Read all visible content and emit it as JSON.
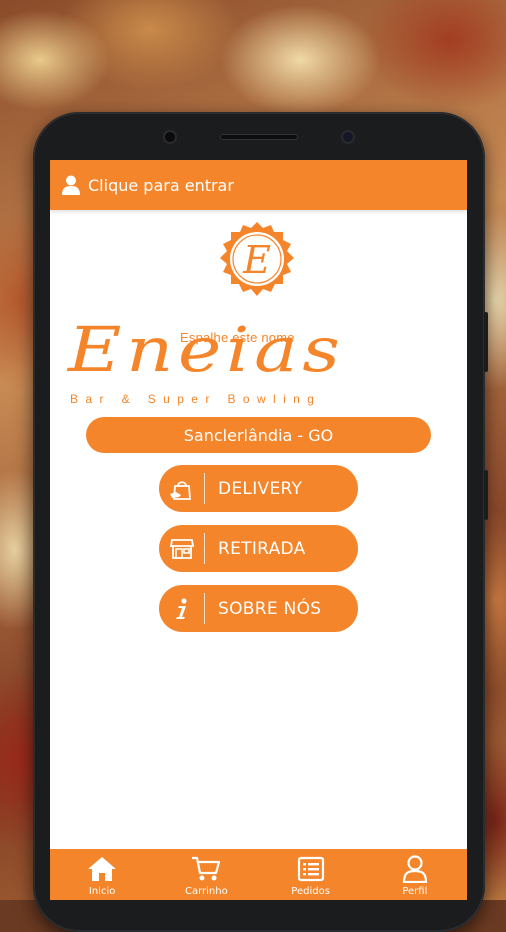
{
  "header": {
    "login_text": "Clique para entrar",
    "user_icon": "user-icon"
  },
  "brand": {
    "emblem_letter": "E",
    "tagline": "Espalhe este nome",
    "name": "Eneias",
    "subtitle": "Bar & Super Bowling"
  },
  "location": {
    "city": "Sanclerlândia - GO"
  },
  "menu": [
    {
      "label": "DELIVERY",
      "icon": "delivery-bag-icon"
    },
    {
      "label": "RETIRADA",
      "icon": "storefront-icon"
    },
    {
      "label": "SOBRE NÓS",
      "icon": "info-icon"
    }
  ],
  "bottom_nav": [
    {
      "label": "Inicio",
      "icon": "home-icon"
    },
    {
      "label": "Carrinho",
      "icon": "cart-icon"
    },
    {
      "label": "Pedidos",
      "icon": "orders-list-icon"
    },
    {
      "label": "Perfil",
      "icon": "profile-icon"
    }
  ],
  "colors": {
    "accent": "#f5852a",
    "text_on_accent": "#ffffff",
    "screen_bg": "#ffffff"
  }
}
